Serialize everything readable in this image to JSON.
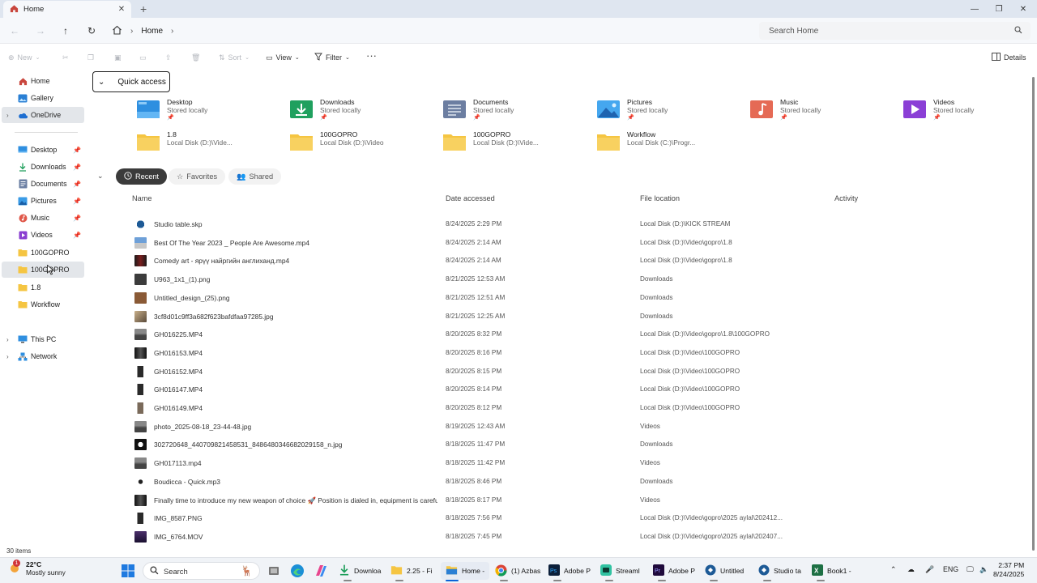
{
  "tab": {
    "title": "Home",
    "close": "✕",
    "new": "+"
  },
  "window_controls": {
    "minimize": "—",
    "maximize": "❐",
    "close": "✕"
  },
  "address": {
    "home_label": "Home",
    "sep": "›",
    "search_placeholder": "Search Home"
  },
  "command_bar": {
    "new_label": "New",
    "sort_label": "Sort",
    "view_label": "View",
    "filter_label": "Filter",
    "more_label": "···",
    "details_label": "Details"
  },
  "sidebar": {
    "top": [
      {
        "label": "Home"
      },
      {
        "label": "Gallery"
      },
      {
        "label": "OneDrive"
      }
    ],
    "pinned": [
      {
        "label": "Desktop"
      },
      {
        "label": "Downloads"
      },
      {
        "label": "Documents"
      },
      {
        "label": "Pictures"
      },
      {
        "label": "Music"
      },
      {
        "label": "Videos"
      }
    ],
    "folders": [
      {
        "label": "100GOPRO"
      },
      {
        "label": "100GOPRO"
      },
      {
        "label": "1.8"
      },
      {
        "label": "Workflow"
      }
    ],
    "bottom": [
      {
        "label": "This PC"
      },
      {
        "label": "Network"
      }
    ],
    "status": "30 items"
  },
  "quick_access": {
    "header": "Quick access",
    "tiles": [
      {
        "name": "Desktop",
        "sub": "Stored locally",
        "icon": "desktop",
        "pinned": true
      },
      {
        "name": "Downloads",
        "sub": "Stored locally",
        "icon": "downloads",
        "pinned": true
      },
      {
        "name": "Documents",
        "sub": "Stored locally",
        "icon": "documents",
        "pinned": true
      },
      {
        "name": "Pictures",
        "sub": "Stored locally",
        "icon": "pictures",
        "pinned": true
      },
      {
        "name": "Music",
        "sub": "Stored locally",
        "icon": "music",
        "pinned": true
      },
      {
        "name": "Videos",
        "sub": "Stored locally",
        "icon": "videos",
        "pinned": true
      },
      {
        "name": "1.8",
        "sub": "Local Disk (D:)\\Vide...",
        "icon": "folder",
        "pinned": false
      },
      {
        "name": "100GOPRO",
        "sub": "Local Disk (D:)\\Video",
        "icon": "folder",
        "pinned": false
      },
      {
        "name": "100GOPRO",
        "sub": "Local Disk (D:)\\Vide...",
        "icon": "folder",
        "pinned": false
      },
      {
        "name": "Workflow",
        "sub": "Local Disk (C:)\\Progr...",
        "icon": "folder",
        "pinned": false
      }
    ]
  },
  "filters": {
    "recent": "Recent",
    "favorites": "Favorites",
    "shared": "Shared"
  },
  "columns": {
    "name": "Name",
    "date": "Date accessed",
    "location": "File location",
    "activity": "Activity"
  },
  "files": [
    {
      "name": "Studio table.skp",
      "date": "8/24/2025 2:29 PM",
      "loc": "Local Disk (D:)\\KICK STREAM",
      "thumb": "sketchup"
    },
    {
      "name": "Best Of The Year 2023 _ People Are Awesome.mp4",
      "date": "8/24/2025 2:14 AM",
      "loc": "Local Disk (D:)\\Video\\gopro\\1.8",
      "thumb": "video-sky"
    },
    {
      "name": "Comedy art - ярүү найргийн англиханд.mp4",
      "date": "8/24/2025 2:14 AM",
      "loc": "Local Disk (D:)\\Video\\gopro\\1.8",
      "thumb": "video-red"
    },
    {
      "name": "U963_1x1_(1).png",
      "date": "8/21/2025 12:53 AM",
      "loc": "Downloads",
      "thumb": "dark"
    },
    {
      "name": "Untitled_design_(25).png",
      "date": "8/21/2025 12:51 AM",
      "loc": "Downloads",
      "thumb": "brown"
    },
    {
      "name": "3cf8d01c9ff3a682f623bafdfaa97285.jpg",
      "date": "8/21/2025 12:25 AM",
      "loc": "Downloads",
      "thumb": "photo"
    },
    {
      "name": "GH016225.MP4",
      "date": "8/20/2025 8:32 PM",
      "loc": "Local Disk (D:)\\Video\\gopro\\1.8\\100GOPRO",
      "thumb": "video-grey"
    },
    {
      "name": "GH016153.MP4",
      "date": "8/20/2025 8:16 PM",
      "loc": "Local Disk (D:)\\Video\\100GOPRO",
      "thumb": "video-dark"
    },
    {
      "name": "GH016152.MP4",
      "date": "8/20/2025 8:15 PM",
      "loc": "Local Disk (D:)\\Video\\100GOPRO",
      "thumb": "portrait"
    },
    {
      "name": "GH016147.MP4",
      "date": "8/20/2025 8:14 PM",
      "loc": "Local Disk (D:)\\Video\\100GOPRO",
      "thumb": "portrait"
    },
    {
      "name": "GH016149.MP4",
      "date": "8/20/2025 8:12 PM",
      "loc": "Local Disk (D:)\\Video\\100GOPRO",
      "thumb": "portrait-light"
    },
    {
      "name": "photo_2025-08-18_23-44-48.jpg",
      "date": "8/19/2025 12:43 AM",
      "loc": "Videos",
      "thumb": "video-grey"
    },
    {
      "name": "302720648_440709821458531_8486480346682029158_n.jpg",
      "date": "8/18/2025 11:47 PM",
      "loc": "Downloads",
      "thumb": "logo"
    },
    {
      "name": "GH017113.mp4",
      "date": "8/18/2025 11:42 PM",
      "loc": "Videos",
      "thumb": "video-grey"
    },
    {
      "name": "Boudicca - Quick.mp3",
      "date": "8/18/2025 8:46 PM",
      "loc": "Downloads",
      "thumb": "audio"
    },
    {
      "name": "Finally time to introduce my new weapon of choice 🚀 Position is dialed in, equipment is carefu...",
      "date": "8/18/2025 8:17 PM",
      "loc": "Videos",
      "thumb": "video-dark"
    },
    {
      "name": "IMG_8587.PNG",
      "date": "8/18/2025 7:56 PM",
      "loc": "Local Disk (D:)\\Video\\gopro\\2025 aylal\\202412...",
      "thumb": "portrait"
    },
    {
      "name": "IMG_6764.MOV",
      "date": "8/18/2025 7:45 PM",
      "loc": "Local Disk (D:)\\Video\\gopro\\2025 aylal\\202407...",
      "thumb": "mov"
    }
  ],
  "taskbar": {
    "weather_temp": "22°C",
    "weather_cond": "Mostly sunny",
    "search_label": "Search",
    "apps": [
      {
        "label": "Downloa",
        "icon": "download-app"
      },
      {
        "label": "2.25 - Fi",
        "icon": "folder-app"
      },
      {
        "label": "Home -",
        "icon": "explorer-app"
      },
      {
        "label": "(1) Azbas",
        "icon": "chrome-app"
      },
      {
        "label": "Adobe P",
        "icon": "photoshop-app"
      },
      {
        "label": "Streaml",
        "icon": "streamlabs-app"
      },
      {
        "label": "Adobe P",
        "icon": "premiere-app"
      },
      {
        "label": "Untitled",
        "icon": "sketchup-app"
      },
      {
        "label": "Studio ta",
        "icon": "sketchup-app-2"
      },
      {
        "label": "Book1 -",
        "icon": "excel-app"
      }
    ],
    "lang": "ENG",
    "time": "2:37 PM",
    "date": "8/24/2025",
    "notification_count": "1"
  },
  "colors": {
    "accent": "#0a64d8",
    "folder": "#f5c542",
    "selected": "#e3e6ea"
  }
}
